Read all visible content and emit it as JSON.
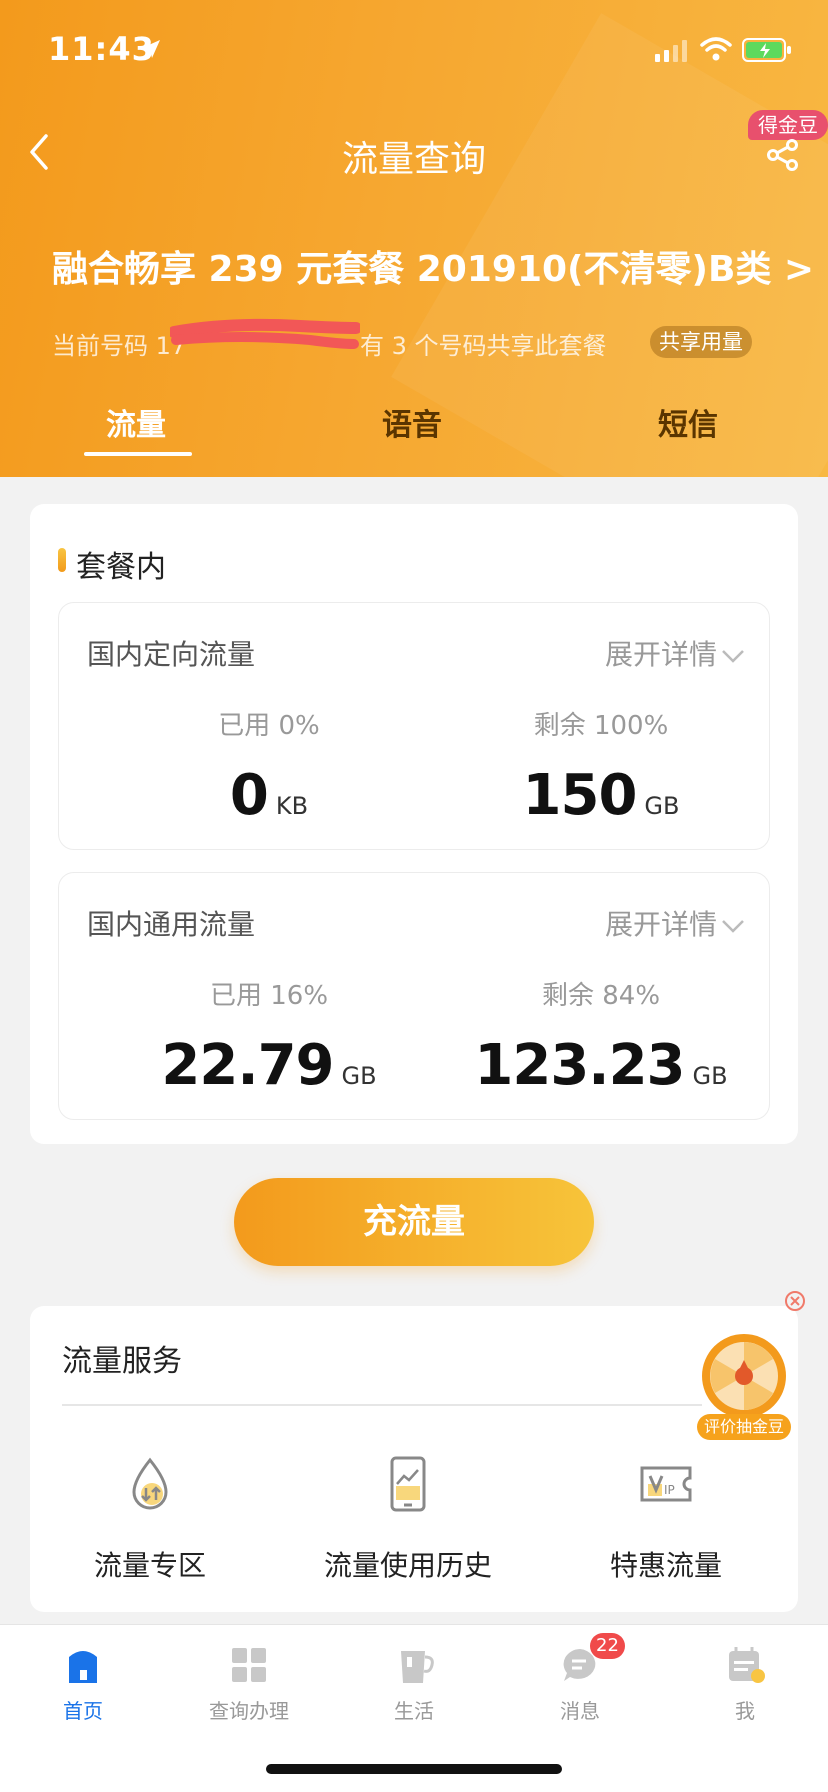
{
  "status_bar": {
    "time": "11:43"
  },
  "nav": {
    "title": "流量查询",
    "coin_badge": "得金豆"
  },
  "plan": {
    "name": "融合畅享 239 元套餐 201910(不清零)B类 >",
    "current_number_label": "当前号码 17",
    "share_info": "有 3 个号码共享此套餐",
    "shared_tag": "共享用量"
  },
  "tabs": [
    {
      "label": "流量",
      "active": true
    },
    {
      "label": "语音",
      "active": false
    },
    {
      "label": "短信",
      "active": false
    }
  ],
  "package": {
    "section_title": "套餐内",
    "expand_label": "展开详情",
    "items": [
      {
        "title": "国内定向流量",
        "used_label": "已用 0%",
        "used_value": "0",
        "used_unit": "KB",
        "remain_label": "剩余 100%",
        "remain_value": "150",
        "remain_unit": "GB"
      },
      {
        "title": "国内通用流量",
        "used_label": "已用 16%",
        "used_value": "22.79",
        "used_unit": "GB",
        "remain_label": "剩余 84%",
        "remain_value": "123.23",
        "remain_unit": "GB"
      }
    ]
  },
  "recharge_label": "充流量",
  "service": {
    "title": "流量服务",
    "items": [
      {
        "label": "流量专区",
        "icon": "drop-arrows-icon"
      },
      {
        "label": "流量使用历史",
        "icon": "phone-chart-icon"
      },
      {
        "label": "特惠流量",
        "icon": "vip-ticket-icon"
      }
    ]
  },
  "promo_label": "评价抽金豆",
  "tabbar": [
    {
      "label": "首页",
      "active": true
    },
    {
      "label": "查询办理",
      "active": false
    },
    {
      "label": "生活",
      "active": false
    },
    {
      "label": "消息",
      "active": false,
      "badge": "22"
    },
    {
      "label": "我",
      "active": false
    }
  ],
  "colors": {
    "header_orange": "#f39a1c",
    "accent_blue": "#1a73e8",
    "badge_red": "#f04a4a"
  }
}
